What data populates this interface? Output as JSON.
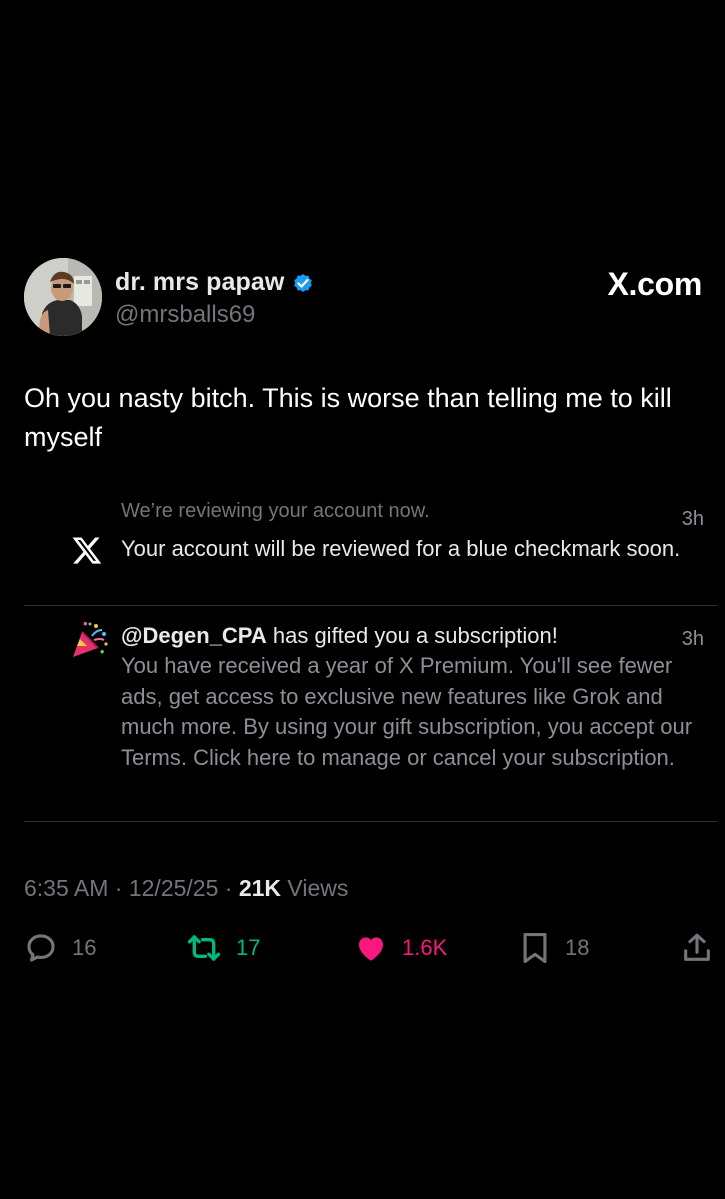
{
  "author": {
    "display_name": "dr. mrs papaw",
    "handle": "@mrsballs69",
    "avatar_icon": "profile-photo",
    "verified_icon": "verified-badge-icon"
  },
  "site_label": "X.com",
  "tweet": {
    "text": "Oh you nasty bitch. This is worse than telling me to kill myself"
  },
  "notifications": [
    {
      "icon": "x-logo-icon",
      "header": "We’re reviewing your account now.",
      "body": "Your account will be reviewed for a blue checkmark soon.",
      "time": "3h"
    },
    {
      "icon": "party-popper-icon",
      "mention": "@Degen_CPA",
      "title_rest": " has gifted you a subscription!",
      "body": "You have received a year of X Premium. You'll see fewer ads, get access to exclusive new features like Grok and much more. By using your gift subscription, you accept our Terms. Click here to manage or cancel your subscription.",
      "time": "3h"
    }
  ],
  "meta": {
    "time": "6:35 AM",
    "sep1": " · ",
    "date": "12/25/25",
    "sep2": " · ",
    "views_count": "21K",
    "views_label": " Views"
  },
  "actions": {
    "replies": "16",
    "reposts": "17",
    "likes": "1.6K",
    "bookmarks": "18"
  },
  "colors": {
    "background": "#000000",
    "text": "#e7e9ea",
    "muted": "#71767b",
    "verified": "#1d9bf0",
    "repost": "#00ba7c",
    "like": "#f91880"
  }
}
